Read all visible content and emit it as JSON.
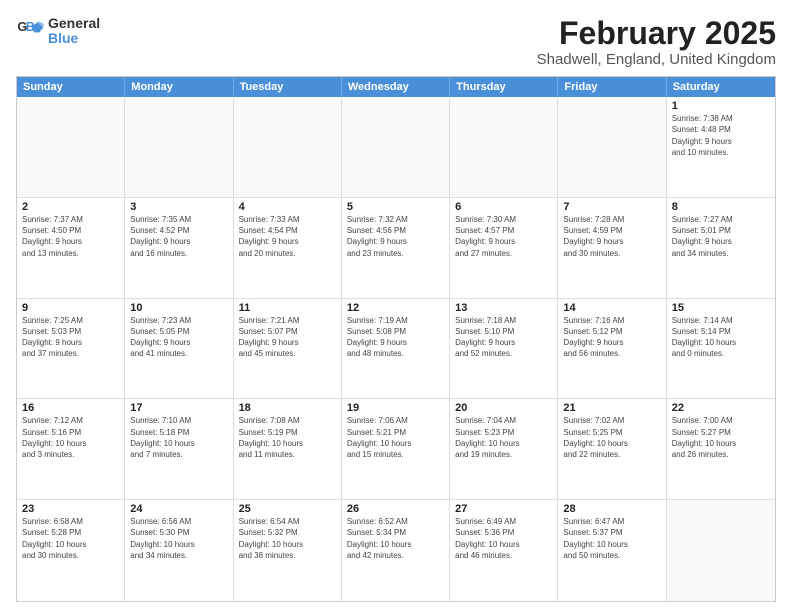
{
  "logo": {
    "line1": "General",
    "line2": "Blue"
  },
  "title": "February 2025",
  "subtitle": "Shadwell, England, United Kingdom",
  "days": [
    "Sunday",
    "Monday",
    "Tuesday",
    "Wednesday",
    "Thursday",
    "Friday",
    "Saturday"
  ],
  "weeks": [
    [
      {
        "num": "",
        "info": ""
      },
      {
        "num": "",
        "info": ""
      },
      {
        "num": "",
        "info": ""
      },
      {
        "num": "",
        "info": ""
      },
      {
        "num": "",
        "info": ""
      },
      {
        "num": "",
        "info": ""
      },
      {
        "num": "1",
        "info": "Sunrise: 7:38 AM\nSunset: 4:48 PM\nDaylight: 9 hours\nand 10 minutes."
      }
    ],
    [
      {
        "num": "2",
        "info": "Sunrise: 7:37 AM\nSunset: 4:50 PM\nDaylight: 9 hours\nand 13 minutes."
      },
      {
        "num": "3",
        "info": "Sunrise: 7:35 AM\nSunset: 4:52 PM\nDaylight: 9 hours\nand 16 minutes."
      },
      {
        "num": "4",
        "info": "Sunrise: 7:33 AM\nSunset: 4:54 PM\nDaylight: 9 hours\nand 20 minutes."
      },
      {
        "num": "5",
        "info": "Sunrise: 7:32 AM\nSunset: 4:56 PM\nDaylight: 9 hours\nand 23 minutes."
      },
      {
        "num": "6",
        "info": "Sunrise: 7:30 AM\nSunset: 4:57 PM\nDaylight: 9 hours\nand 27 minutes."
      },
      {
        "num": "7",
        "info": "Sunrise: 7:28 AM\nSunset: 4:59 PM\nDaylight: 9 hours\nand 30 minutes."
      },
      {
        "num": "8",
        "info": "Sunrise: 7:27 AM\nSunset: 5:01 PM\nDaylight: 9 hours\nand 34 minutes."
      }
    ],
    [
      {
        "num": "9",
        "info": "Sunrise: 7:25 AM\nSunset: 5:03 PM\nDaylight: 9 hours\nand 37 minutes."
      },
      {
        "num": "10",
        "info": "Sunrise: 7:23 AM\nSunset: 5:05 PM\nDaylight: 9 hours\nand 41 minutes."
      },
      {
        "num": "11",
        "info": "Sunrise: 7:21 AM\nSunset: 5:07 PM\nDaylight: 9 hours\nand 45 minutes."
      },
      {
        "num": "12",
        "info": "Sunrise: 7:19 AM\nSunset: 5:08 PM\nDaylight: 9 hours\nand 48 minutes."
      },
      {
        "num": "13",
        "info": "Sunrise: 7:18 AM\nSunset: 5:10 PM\nDaylight: 9 hours\nand 52 minutes."
      },
      {
        "num": "14",
        "info": "Sunrise: 7:16 AM\nSunset: 5:12 PM\nDaylight: 9 hours\nand 56 minutes."
      },
      {
        "num": "15",
        "info": "Sunrise: 7:14 AM\nSunset: 5:14 PM\nDaylight: 10 hours\nand 0 minutes."
      }
    ],
    [
      {
        "num": "16",
        "info": "Sunrise: 7:12 AM\nSunset: 5:16 PM\nDaylight: 10 hours\nand 3 minutes."
      },
      {
        "num": "17",
        "info": "Sunrise: 7:10 AM\nSunset: 5:18 PM\nDaylight: 10 hours\nand 7 minutes."
      },
      {
        "num": "18",
        "info": "Sunrise: 7:08 AM\nSunset: 5:19 PM\nDaylight: 10 hours\nand 11 minutes."
      },
      {
        "num": "19",
        "info": "Sunrise: 7:06 AM\nSunset: 5:21 PM\nDaylight: 10 hours\nand 15 minutes."
      },
      {
        "num": "20",
        "info": "Sunrise: 7:04 AM\nSunset: 5:23 PM\nDaylight: 10 hours\nand 19 minutes."
      },
      {
        "num": "21",
        "info": "Sunrise: 7:02 AM\nSunset: 5:25 PM\nDaylight: 10 hours\nand 22 minutes."
      },
      {
        "num": "22",
        "info": "Sunrise: 7:00 AM\nSunset: 5:27 PM\nDaylight: 10 hours\nand 26 minutes."
      }
    ],
    [
      {
        "num": "23",
        "info": "Sunrise: 6:58 AM\nSunset: 5:28 PM\nDaylight: 10 hours\nand 30 minutes."
      },
      {
        "num": "24",
        "info": "Sunrise: 6:56 AM\nSunset: 5:30 PM\nDaylight: 10 hours\nand 34 minutes."
      },
      {
        "num": "25",
        "info": "Sunrise: 6:54 AM\nSunset: 5:32 PM\nDaylight: 10 hours\nand 38 minutes."
      },
      {
        "num": "26",
        "info": "Sunrise: 6:52 AM\nSunset: 5:34 PM\nDaylight: 10 hours\nand 42 minutes."
      },
      {
        "num": "27",
        "info": "Sunrise: 6:49 AM\nSunset: 5:36 PM\nDaylight: 10 hours\nand 46 minutes."
      },
      {
        "num": "28",
        "info": "Sunrise: 6:47 AM\nSunset: 5:37 PM\nDaylight: 10 hours\nand 50 minutes."
      },
      {
        "num": "",
        "info": ""
      }
    ]
  ]
}
